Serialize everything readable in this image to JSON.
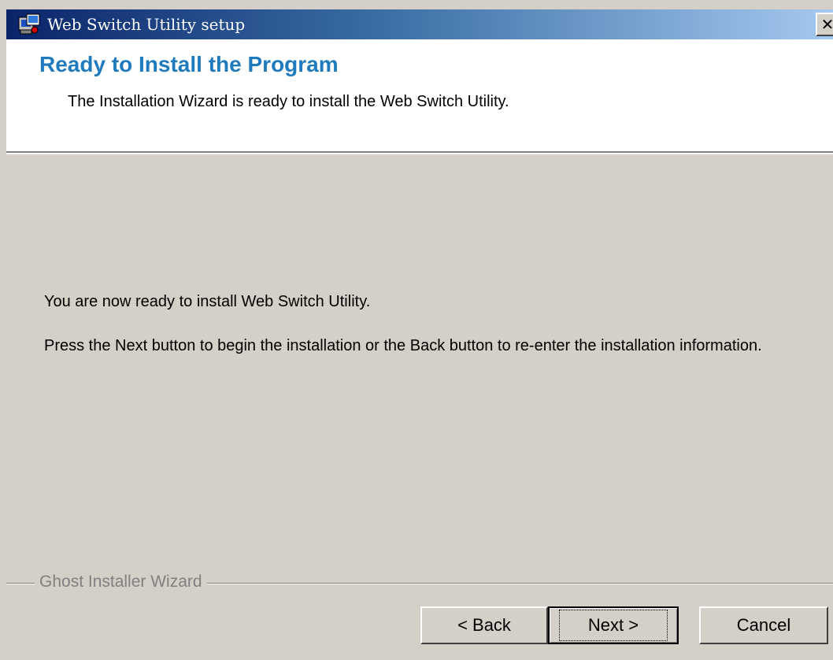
{
  "window": {
    "title": "Web Switch Utility setup",
    "close_glyph": "✕"
  },
  "header": {
    "title": "Ready to Install the Program",
    "subtitle": "The Installation Wizard is ready to install the Web Switch Utility."
  },
  "body": {
    "paragraph1": "You are now ready to install Web Switch Utility.",
    "paragraph2": "Press the Next button to begin the installation or the Back button to re-enter the installation information."
  },
  "footer": {
    "group_label": "Ghost Installer Wizard",
    "back_label": "< Back",
    "next_label": "Next >",
    "cancel_label": "Cancel"
  },
  "colors": {
    "title_bar_start": "#0a246a",
    "title_bar_end": "#a6caf0",
    "header_title": "#1f7bbd",
    "dialog_bg": "#d4d0c8"
  },
  "icons": {
    "app_icon": "installer-icon",
    "close_icon": "close-icon"
  }
}
